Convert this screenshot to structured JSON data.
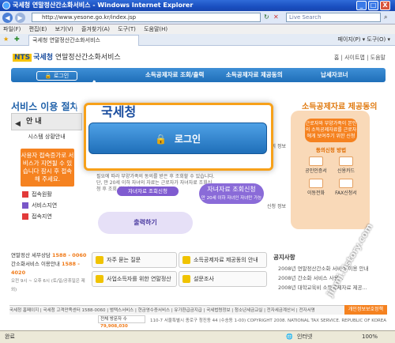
{
  "window": {
    "title": "국세청 연말정산간소화서비스 - Windows Internet Explorer",
    "minimize": "_",
    "maximize": "□",
    "close": "X"
  },
  "address": {
    "url": "http://www.yesone.go.kr/index.jsp",
    "search_placeholder": "Live Search"
  },
  "menu": [
    "파일(F)",
    "편집(E)",
    "보기(V)",
    "즐겨찾기(A)",
    "도구(T)",
    "도움말(H)"
  ],
  "tab": {
    "label": "국세청 연말정산간소화서비스",
    "tools": "페이지(P) ▾   도구(O) ▾"
  },
  "site": {
    "logo_badge": "NTS",
    "logo_name": "국세청",
    "service_name": "연말정산간소화서비스",
    "top_links": "홈 | 사이트맵 | 도움말"
  },
  "gnb": {
    "login": "로그인",
    "m1": "소득공제자료 조회/출력",
    "m2": "소득공제자료 제공동의",
    "m3": "납세자코너"
  },
  "sections": {
    "service_title": "서비스 이용 절차",
    "fee_title": "소득공제자료 제공동의",
    "notice_tab": "안 내",
    "status_label": "시스템 상황안내",
    "status_warn": "사용자 접속증가로 서비스가 지연될 수 있습니다 잠시 후 접속해 주세요.",
    "legend": [
      "접속원활",
      "서비스지연",
      "접속지연"
    ]
  },
  "login": {
    "logo": "국세청",
    "button": "로그인",
    "icon": "lock-icon"
  },
  "flow": {
    "mid_text": "필요에 따라 부양가족의 동의를 받은 후 조회할 수 있습니다. 단, 만 20세 이하 자녀의 자료는 근로자가 자녀자료 조회신청 후 조회 가능합니다.",
    "mid_btn": "자녀자료 조회신청",
    "child_title": "자녀자료 조회신청",
    "child_sub": "만 20세 이하 자녀인 자녀만 가능",
    "print": "출력하기",
    "side1": "동의 정보",
    "side2": "신청 정보"
  },
  "fee": {
    "head": "근로자와 부양가족이 본인의 소득공제자료를 근로자에게 보여주기 위한 신청",
    "sub": "동의신청 방법",
    "items": [
      "공인인증서",
      "신용카드",
      "이동전화",
      "FAX신청서"
    ]
  },
  "contact": {
    "l1_label": "연말정산 세무상담",
    "l1_num": "1588 - 0060",
    "l2_label": "간소화서비스 이용안내",
    "l2_num": "1588 - 4020",
    "hours": "오전 9시 ~ 오후 6시 (토/일/공휴일은 제외)"
  },
  "quick": [
    "자주 묻는 질문",
    "소득공제자료 제공동의 안내",
    "사업소득자를 위한 연말정산",
    "설문조사"
  ],
  "notices": {
    "title": "공지사항",
    "items": [
      "2008년 연말정산간소화 서비스 이용 안내",
      "2008년 간소화 서비스 사용...",
      "2008년 대학교육비 소득공제자료 제공..."
    ]
  },
  "footer": {
    "links": "국세청 홈페이지 | 국세청 고객만족센터 1588-0060 | 범택스서비스 | 현금영수증서비스 | 유가환급금지급 | 국세법령정보 | 청소년세금교실 | 전자세금계산서 | 전자서명",
    "policy": "개인정보보호정책",
    "visitor_label": "전체 방문자 수",
    "visitor_count": "79,908,030",
    "address": "110-7 서울특별시 종로구 청진동 44 (수송동 1-00)   COPYRIGHT 2008. NATIONAL TAX SERVICE. REPUBLIC OF KOREA"
  },
  "statusbar": {
    "left": "완료",
    "zone": "인터넷",
    "zoom": "100%"
  },
  "watermark": "jinmi.tistory.com"
}
